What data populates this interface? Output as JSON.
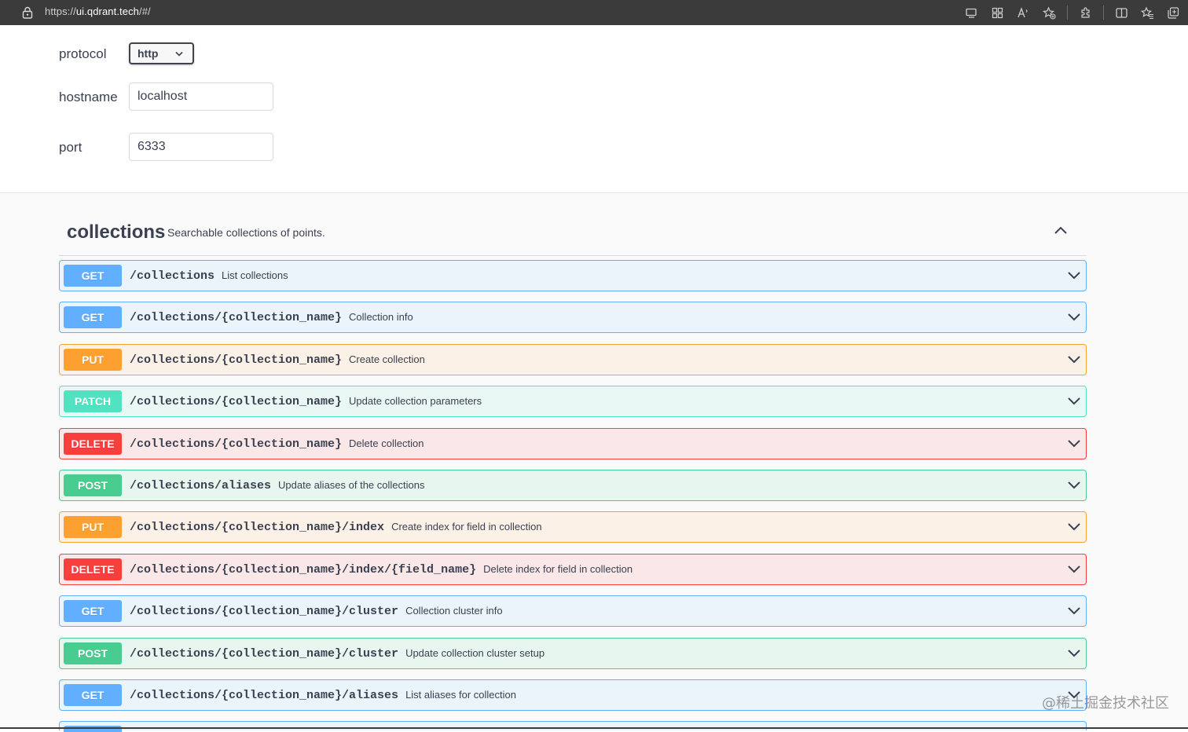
{
  "browser": {
    "url_scheme": "https://",
    "url_host": "ui.qdrant.tech",
    "url_path": "/#/"
  },
  "config": {
    "protocol_label": "protocol",
    "protocol_value": "http",
    "hostname_label": "hostname",
    "hostname_value": "localhost",
    "port_label": "port",
    "port_value": "6333"
  },
  "tag": {
    "name": "collections",
    "description": "Searchable collections of points."
  },
  "operations": [
    {
      "method": "GET",
      "path": "/collections",
      "summary": "List collections"
    },
    {
      "method": "GET",
      "path": "/collections/{collection_name}",
      "summary": "Collection info"
    },
    {
      "method": "PUT",
      "path": "/collections/{collection_name}",
      "summary": "Create collection"
    },
    {
      "method": "PATCH",
      "path": "/collections/{collection_name}",
      "summary": "Update collection parameters"
    },
    {
      "method": "DELETE",
      "path": "/collections/{collection_name}",
      "summary": "Delete collection"
    },
    {
      "method": "POST",
      "path": "/collections/aliases",
      "summary": "Update aliases of the collections"
    },
    {
      "method": "PUT",
      "path": "/collections/{collection_name}/index",
      "summary": "Create index for field in collection"
    },
    {
      "method": "DELETE",
      "path": "/collections/{collection_name}/index/{field_name}",
      "summary": "Delete index for field in collection"
    },
    {
      "method": "GET",
      "path": "/collections/{collection_name}/cluster",
      "summary": "Collection cluster info"
    },
    {
      "method": "POST",
      "path": "/collections/{collection_name}/cluster",
      "summary": "Update collection cluster setup"
    },
    {
      "method": "GET",
      "path": "/collections/{collection_name}/aliases",
      "summary": "List aliases for collection"
    }
  ],
  "watermark": "@稀土掘金技术社区",
  "colors": {
    "get": "#61affe",
    "put": "#fca130",
    "patch": "#50e3c2",
    "delete": "#f93e3e",
    "post": "#49cc90"
  },
  "icons": [
    "lock-icon",
    "screen-cast-icon",
    "apps-icon",
    "read-aloud-icon",
    "favorite-add-icon",
    "extensions-icon",
    "split-screen-icon",
    "favorites-icon",
    "collections-icon",
    "chevron-up-icon",
    "chevron-down-icon"
  ]
}
